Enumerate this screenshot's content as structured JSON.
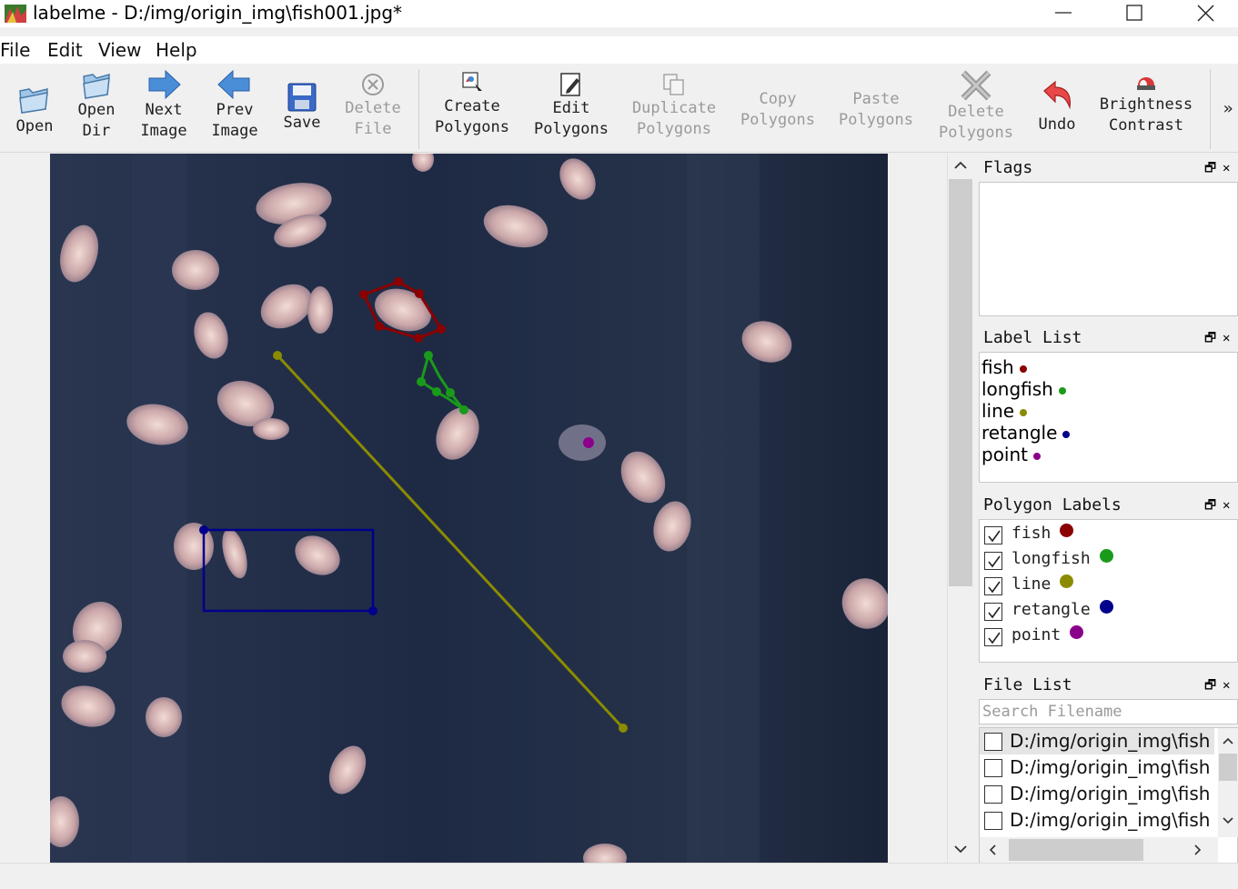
{
  "window": {
    "title": "labelme - D:/img/origin_img\\fish001.jpg*",
    "minimize_label": "minimize",
    "maximize_label": "maximize",
    "close_label": "close"
  },
  "menu": [
    "File",
    "Edit",
    "View",
    "Help"
  ],
  "toolbar": {
    "open": "Open",
    "open_dir": "Open\nDir",
    "next_image": "Next\nImage",
    "prev_image": "Prev\nImage",
    "save": "Save",
    "delete_file": "Delete\nFile",
    "create_polygons": "Create\nPolygons",
    "edit_polygons": "Edit\nPolygons",
    "duplicate_polygons": "Duplicate\nPolygons",
    "copy_polygons": "Copy\nPolygons",
    "paste_polygons": "Paste\nPolygons",
    "delete_polygons": "Delete\nPolygons",
    "undo": "Undo",
    "brightness_contrast": "Brightness\nContrast",
    "more": "»"
  },
  "docks": {
    "flags": {
      "title": "Flags"
    },
    "label_list": {
      "title": "Label List",
      "items": [
        {
          "name": "fish",
          "color": "#8b0000"
        },
        {
          "name": "longfish",
          "color": "#1a9a1a"
        },
        {
          "name": "line",
          "color": "#8b8b00"
        },
        {
          "name": "retangle",
          "color": "#00008b"
        },
        {
          "name": "point",
          "color": "#8b008b"
        }
      ]
    },
    "polygon_labels": {
      "title": "Polygon Labels",
      "items": [
        {
          "name": "fish",
          "color": "#8b0000",
          "checked": true
        },
        {
          "name": "longfish",
          "color": "#1a9a1a",
          "checked": true
        },
        {
          "name": "line",
          "color": "#8b8b00",
          "checked": true
        },
        {
          "name": "retangle",
          "color": "#00008b",
          "checked": true
        },
        {
          "name": "point",
          "color": "#8b008b",
          "checked": true
        }
      ]
    },
    "file_list": {
      "title": "File List",
      "search_placeholder": "Search Filename",
      "items": [
        "D:/img/origin_img\\fish",
        "D:/img/origin_img\\fish",
        "D:/img/origin_img\\fish",
        "D:/img/origin_img\\fish"
      ]
    }
  },
  "dock_controls": {
    "float": "🗗",
    "close": "✕"
  },
  "shape_colors": {
    "fish": "#8b0000",
    "longfish": "#1a9a1a",
    "line": "#8b8b00",
    "retangle": "#00008b",
    "point": "#8b008b"
  }
}
